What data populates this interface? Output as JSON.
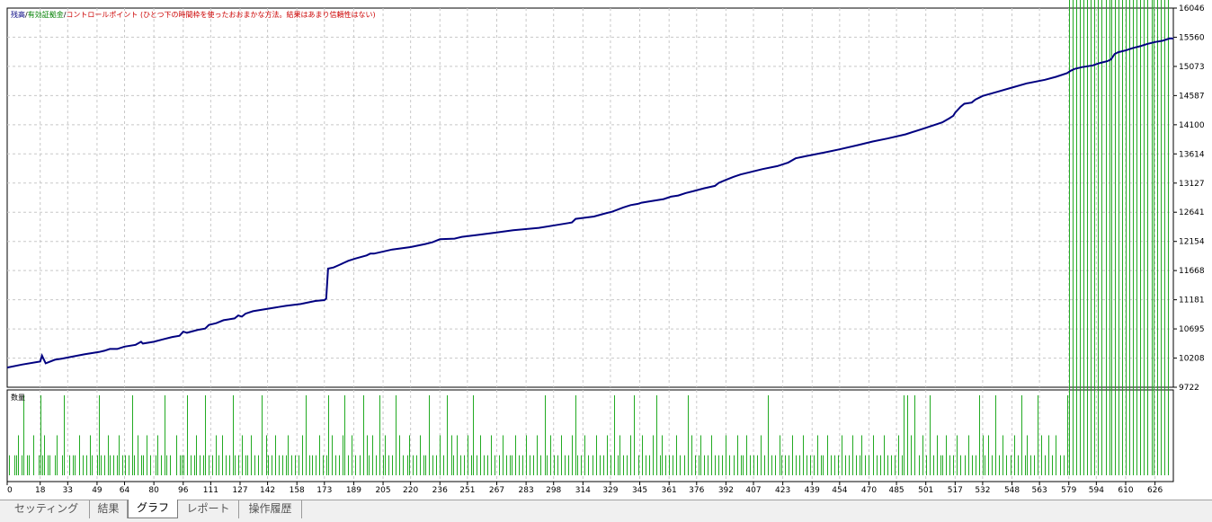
{
  "tabs": [
    {
      "label": "セッティング",
      "active": false
    },
    {
      "label": "結果",
      "active": false
    },
    {
      "label": "グラフ",
      "active": true
    },
    {
      "label": "レポート",
      "active": false
    },
    {
      "label": "操作履歴",
      "active": false
    }
  ],
  "colors": {
    "balance": "#000080",
    "equity": "#008000",
    "control": "#cc0000",
    "grid": "#c8c8c8",
    "volume": "#22aa22"
  },
  "chart_data": [
    {
      "type": "line",
      "legend": [
        {
          "label": "残高",
          "color": "#000080"
        },
        {
          "label": "有効証拠金",
          "color": "#008000"
        },
        {
          "label": "コントロールポイント (ひとつ下の時間枠を使ったおおまかな方法。結果はあまり信頼性はない)",
          "color": "#cc0000"
        }
      ],
      "series": [
        {
          "name": "残高",
          "x": [
            0,
            8,
            18,
            19,
            21,
            26,
            30,
            35,
            42,
            50,
            53,
            56,
            60,
            64,
            70,
            73,
            74,
            80,
            85,
            90,
            94,
            96,
            98,
            104,
            108,
            110,
            114,
            118,
            124,
            126,
            128,
            130,
            134,
            140,
            146,
            148,
            152,
            160,
            168,
            173,
            174,
            175,
            178,
            181,
            186,
            190,
            196,
            198,
            200,
            210,
            220,
            228,
            232,
            236,
            244,
            248,
            256,
            266,
            276,
            290,
            300,
            306,
            308,
            310,
            320,
            326,
            330,
            336,
            340,
            344,
            346,
            350,
            358,
            362,
            366,
            370,
            374,
            380,
            386,
            388,
            392,
            396,
            400,
            404,
            412,
            420,
            426,
            430,
            436,
            446,
            454,
            464,
            472,
            480,
            490,
            500,
            510,
            514,
            516,
            517,
            520,
            522,
            526,
            528,
            532,
            540,
            548,
            556,
            566,
            572,
            578,
            580,
            582,
            586,
            592,
            596,
            600,
            602,
            604,
            606,
            610,
            614,
            618,
            622,
            626,
            630,
            634,
            636
          ],
          "values": [
            10050,
            10100,
            10150,
            10250,
            10120,
            10180,
            10200,
            10230,
            10270,
            10310,
            10330,
            10360,
            10360,
            10400,
            10430,
            10480,
            10450,
            10480,
            10520,
            10560,
            10580,
            10650,
            10630,
            10680,
            10700,
            10760,
            10790,
            10840,
            10870,
            10920,
            10900,
            10950,
            10990,
            11020,
            11050,
            11060,
            11080,
            11110,
            11160,
            11175,
            11200,
            11700,
            11720,
            11760,
            11830,
            11870,
            11920,
            11950,
            11950,
            12020,
            12060,
            12110,
            12140,
            12190,
            12200,
            12230,
            12260,
            12300,
            12340,
            12380,
            12430,
            12460,
            12470,
            12530,
            12570,
            12620,
            12650,
            12720,
            12760,
            12780,
            12800,
            12820,
            12860,
            12900,
            12920,
            12960,
            12990,
            13040,
            13080,
            13130,
            13180,
            13230,
            13270,
            13300,
            13360,
            13410,
            13470,
            13540,
            13580,
            13640,
            13690,
            13760,
            13820,
            13870,
            13940,
            14040,
            14140,
            14210,
            14250,
            14300,
            14400,
            14450,
            14470,
            14520,
            14580,
            14650,
            14720,
            14790,
            14850,
            14900,
            14960,
            15000,
            15030,
            15060,
            15090,
            15130,
            15160,
            15190,
            15280,
            15310,
            15340,
            15380,
            15410,
            15450,
            15480,
            15500,
            15540,
            15540
          ]
        }
      ],
      "yticks": [
        "9722",
        "10208",
        "10695",
        "11181",
        "11668",
        "12154",
        "12641",
        "13127",
        "13614",
        "14100",
        "14587",
        "15073",
        "15560",
        "16046"
      ],
      "ylim": [
        9722,
        16046
      ],
      "xlim": [
        0,
        636
      ],
      "grid": true
    },
    {
      "type": "bar",
      "legend": [
        {
          "label": "数量",
          "color": "#000000"
        }
      ],
      "x": [
        1,
        4,
        5,
        6,
        8,
        9,
        11,
        12,
        14,
        17,
        18,
        19,
        20,
        22,
        23,
        26,
        27,
        30,
        31,
        34,
        36,
        37,
        39,
        41,
        43,
        45,
        46,
        49,
        50,
        51,
        53,
        55,
        56,
        58,
        60,
        61,
        63,
        64,
        66,
        68,
        69,
        71,
        73,
        74,
        76,
        78,
        81,
        82,
        84,
        86,
        87,
        89,
        92,
        94,
        95,
        96,
        98,
        100,
        102,
        103,
        105,
        107,
        108,
        110,
        112,
        114,
        115,
        117,
        119,
        121,
        123,
        124,
        126,
        128,
        130,
        131,
        133,
        135,
        137,
        139,
        141,
        142,
        144,
        146,
        148,
        150,
        152,
        153,
        155,
        157,
        159,
        161,
        163,
        165,
        166,
        168,
        170,
        172,
        174,
        175,
        177,
        179,
        181,
        183,
        184,
        186,
        188,
        190,
        192,
        194,
        196,
        197,
        199,
        201,
        203,
        205,
        206,
        208,
        210,
        212,
        214,
        216,
        218,
        219,
        221,
        223,
        225,
        227,
        228,
        230,
        232,
        234,
        236,
        238,
        240,
        242,
        243,
        245,
        247,
        249,
        251,
        253,
        254,
        256,
        258,
        260,
        262,
        264,
        266,
        268,
        270,
        272,
        274,
        275,
        277,
        279,
        281,
        283,
        285,
        287,
        289,
        291,
        293,
        294,
        296,
        298,
        300,
        302,
        304,
        306,
        308,
        310,
        311,
        313,
        315,
        317,
        319,
        321,
        323,
        325,
        327,
        329,
        331,
        333,
        334,
        336,
        338,
        340,
        342,
        344,
        346,
        348,
        350,
        352,
        354,
        356,
        357,
        359,
        361,
        363,
        365,
        367,
        369,
        371,
        373,
        375,
        377,
        378,
        380,
        382,
        384,
        386,
        388,
        390,
        392,
        394,
        396,
        398,
        400,
        401,
        403,
        405,
        407,
        409,
        411,
        413,
        415,
        417,
        419,
        421,
        422,
        424,
        426,
        428,
        430,
        432,
        434,
        436,
        438,
        440,
        442,
        444,
        445,
        447,
        449,
        451,
        453,
        455,
        457,
        459,
        461,
        463,
        465,
        466,
        468,
        470,
        472,
        474,
        476,
        478,
        480,
        482,
        484,
        486,
        488,
        489,
        491,
        493,
        495,
        497,
        499,
        501,
        503,
        505,
        507,
        509,
        510,
        512,
        514,
        516,
        518,
        520,
        522,
        524,
        526,
        528,
        530,
        532,
        533,
        535,
        537,
        539,
        541,
        543,
        545,
        547,
        549,
        551,
        553,
        555,
        556,
        558,
        560,
        562,
        564,
        566,
        568,
        570,
        572,
        574,
        576,
        578,
        579,
        581,
        583,
        585,
        587,
        589,
        591,
        593,
        595,
        597,
        599,
        601,
        602,
        604,
        606,
        608,
        610,
        612,
        614,
        616,
        618,
        620,
        622,
        624,
        625,
        627,
        629,
        631,
        633
      ],
      "values": [
        1,
        1,
        1,
        2,
        1,
        4,
        1,
        1,
        2,
        1,
        4,
        1,
        2,
        1,
        1,
        1,
        2,
        1,
        4,
        1,
        1,
        1,
        2,
        1,
        1,
        2,
        1,
        1,
        4,
        1,
        1,
        2,
        1,
        1,
        1,
        2,
        1,
        1,
        1,
        4,
        1,
        2,
        1,
        1,
        2,
        1,
        1,
        2,
        1,
        4,
        1,
        1,
        2,
        1,
        1,
        1,
        4,
        1,
        1,
        2,
        1,
        1,
        4,
        1,
        1,
        2,
        1,
        2,
        1,
        1,
        4,
        1,
        1,
        2,
        1,
        1,
        2,
        1,
        1,
        4,
        2,
        1,
        1,
        2,
        1,
        1,
        1,
        2,
        1,
        1,
        1,
        2,
        4,
        1,
        1,
        1,
        2,
        1,
        1,
        4,
        2,
        1,
        1,
        2,
        4,
        1,
        2,
        1,
        1,
        4,
        2,
        1,
        2,
        1,
        4,
        1,
        2,
        1,
        1,
        4,
        2,
        1,
        1,
        2,
        1,
        1,
        2,
        1,
        1,
        4,
        1,
        1,
        2,
        1,
        4,
        2,
        1,
        2,
        1,
        1,
        2,
        1,
        4,
        1,
        2,
        1,
        1,
        2,
        1,
        1,
        2,
        1,
        1,
        1,
        2,
        1,
        1,
        2,
        1,
        1,
        2,
        1,
        4,
        1,
        2,
        1,
        1,
        2,
        1,
        1,
        2,
        4,
        1,
        1,
        2,
        1,
        1,
        2,
        1,
        1,
        2,
        1,
        4,
        1,
        2,
        1,
        1,
        2,
        4,
        1,
        2,
        1,
        1,
        2,
        4,
        1,
        2,
        1,
        1,
        1,
        2,
        1,
        1,
        4,
        2,
        1,
        1,
        2,
        1,
        1,
        2,
        1,
        1,
        1,
        2,
        1,
        1,
        2,
        1,
        1,
        2,
        1,
        1,
        1,
        2,
        1,
        4,
        1,
        1,
        2,
        1,
        1,
        1,
        2,
        1,
        1,
        2,
        1,
        1,
        1,
        2,
        1,
        1,
        2,
        1,
        1,
        1,
        2,
        1,
        1,
        2,
        1,
        1,
        2,
        1,
        1,
        2,
        1,
        1,
        2,
        1,
        1,
        1,
        2,
        1,
        4,
        4,
        2,
        4,
        1,
        2,
        1,
        4,
        1,
        2,
        1,
        1,
        2,
        1,
        1,
        2,
        1,
        1,
        2,
        1,
        1,
        4,
        2,
        1,
        2,
        1,
        4,
        1,
        2,
        1,
        1,
        2,
        1,
        4,
        1,
        2,
        1,
        1,
        4,
        2,
        1,
        2,
        1,
        2,
        1,
        1,
        4
      ],
      "xticks": [
        "0",
        "18",
        "33",
        "49",
        "64",
        "80",
        "96",
        "111",
        "127",
        "142",
        "158",
        "173",
        "189",
        "205",
        "220",
        "236",
        "251",
        "267",
        "283",
        "298",
        "314",
        "329",
        "345",
        "361",
        "376",
        "392",
        "407",
        "423",
        "439",
        "454",
        "470",
        "485",
        "501",
        "517",
        "532",
        "548",
        "563",
        "579",
        "594",
        "610",
        "626"
      ],
      "xtick_values": [
        0,
        18,
        33,
        49,
        64,
        80,
        96,
        111,
        127,
        142,
        158,
        173,
        189,
        205,
        220,
        236,
        251,
        267,
        283,
        298,
        314,
        329,
        345,
        361,
        376,
        392,
        407,
        423,
        439,
        454,
        470,
        485,
        501,
        517,
        532,
        548,
        563,
        579,
        594,
        610,
        626
      ],
      "ylim": [
        0,
        4
      ],
      "grid": true
    }
  ]
}
